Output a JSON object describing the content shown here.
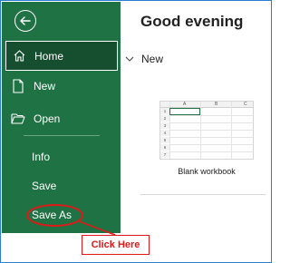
{
  "sidebar": {
    "back_icon": "arrow-left-circle-icon",
    "items": [
      {
        "label": "Home",
        "icon": "home-icon",
        "active": true
      },
      {
        "label": "New",
        "icon": "new-document-icon"
      },
      {
        "label": "Open",
        "icon": "folder-open-icon"
      },
      {
        "label": "Info"
      },
      {
        "label": "Save"
      },
      {
        "label": "Save As",
        "highlighted": true
      }
    ],
    "bg_color": "#1f7244"
  },
  "main": {
    "greeting": "Good evening",
    "new_section_label": "New",
    "templates": [
      {
        "label": "Blank workbook",
        "columns": [
          "A",
          "B",
          "C"
        ],
        "rows": [
          "1",
          "2",
          "3",
          "4",
          "5",
          "6",
          "7"
        ]
      }
    ]
  },
  "annotation": {
    "callout_text": "Click Here",
    "color": "#e01818"
  }
}
